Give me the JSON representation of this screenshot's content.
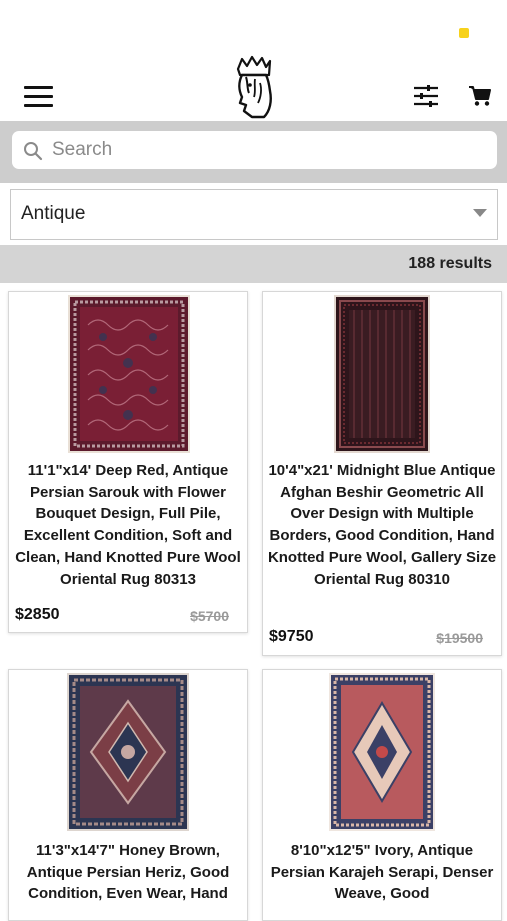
{
  "header": {
    "menu_icon": "hamburger-menu-icon",
    "logo_icon": "king-head-logo-icon",
    "filter_icon": "sliders-filter-icon",
    "cart_icon": "shopping-cart-icon"
  },
  "search": {
    "placeholder": "Search",
    "value": ""
  },
  "category": {
    "selected": "Antique"
  },
  "results": {
    "count_label": "188 results"
  },
  "products": [
    {
      "title": "11'1\"x14' Deep Red, Antique Persian Sarouk with Flower Bouquet Design, Full Pile, Excellent Condition, Soft and Clean, Hand Knotted Pure Wool Oriental Rug 80313",
      "price": "$2850",
      "old_price": "$5700"
    },
    {
      "title": "10'4\"x21' Midnight Blue Antique Afghan Beshir Geometric All Over Design with Multiple Borders, Good Condition, Hand Knotted Pure Wool, Gallery Size Oriental Rug 80310",
      "price": "$9750",
      "old_price": "$19500"
    },
    {
      "title": "11'3\"x14'7\" Honey Brown, Antique Persian Heriz, Good Condition, Even Wear, Hand",
      "price": "",
      "old_price": ""
    },
    {
      "title": "8'10\"x12'5\" Ivory, Antique Persian Karajeh Serapi, Denser Weave, Good",
      "price": "",
      "old_price": ""
    }
  ],
  "colors": {
    "status_dot": "#f7d21c",
    "search_bar_bg": "#cdcdcd",
    "results_bar_bg": "#d4d4d4",
    "rug_deep_red": "#7a1f35",
    "rug_midnight": "#3a1c22",
    "rug_heriz": "#5e3a4a",
    "rug_serapi": "#b85a5e"
  }
}
